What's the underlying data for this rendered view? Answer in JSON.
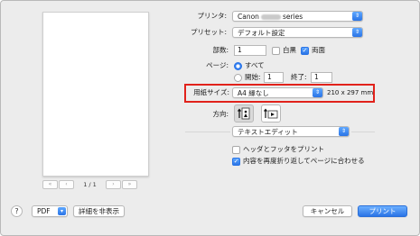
{
  "preview": {
    "page_count": "1 / 1"
  },
  "printer": {
    "label": "プリンタ:",
    "value_prefix": "Canon",
    "value_suffix": "series"
  },
  "preset": {
    "label": "プリセット:",
    "value": "デフォルト設定"
  },
  "copies": {
    "label": "部数:",
    "value": "1",
    "bw_label": "白黒",
    "duplex_label": "両面",
    "bw_checked": false,
    "duplex_checked": true
  },
  "pages": {
    "label": "ページ:",
    "all_label": "すべて",
    "from_label": "開始:",
    "from_value": "1",
    "to_label": "終了:",
    "to_value": "1"
  },
  "paper_size": {
    "label": "用紙サイズ:",
    "value": "A4 縁なし",
    "dimensions": "210 x 297 mm"
  },
  "orientation": {
    "label": "方向:"
  },
  "app_menu": {
    "value": "テキストエディット"
  },
  "options": {
    "header_footer_label": "ヘッダとフッタをプリント",
    "header_footer_checked": false,
    "rewrap_label": "内容を再度折り返してページに合わせる",
    "rewrap_checked": true
  },
  "bottom": {
    "help": "?",
    "pdf_label": "PDF",
    "hide_details_label": "詳細を非表示",
    "cancel_label": "キャンセル",
    "print_label": "プリント"
  },
  "colors": {
    "accent": "#2a74e6",
    "highlight": "#e1221b"
  }
}
